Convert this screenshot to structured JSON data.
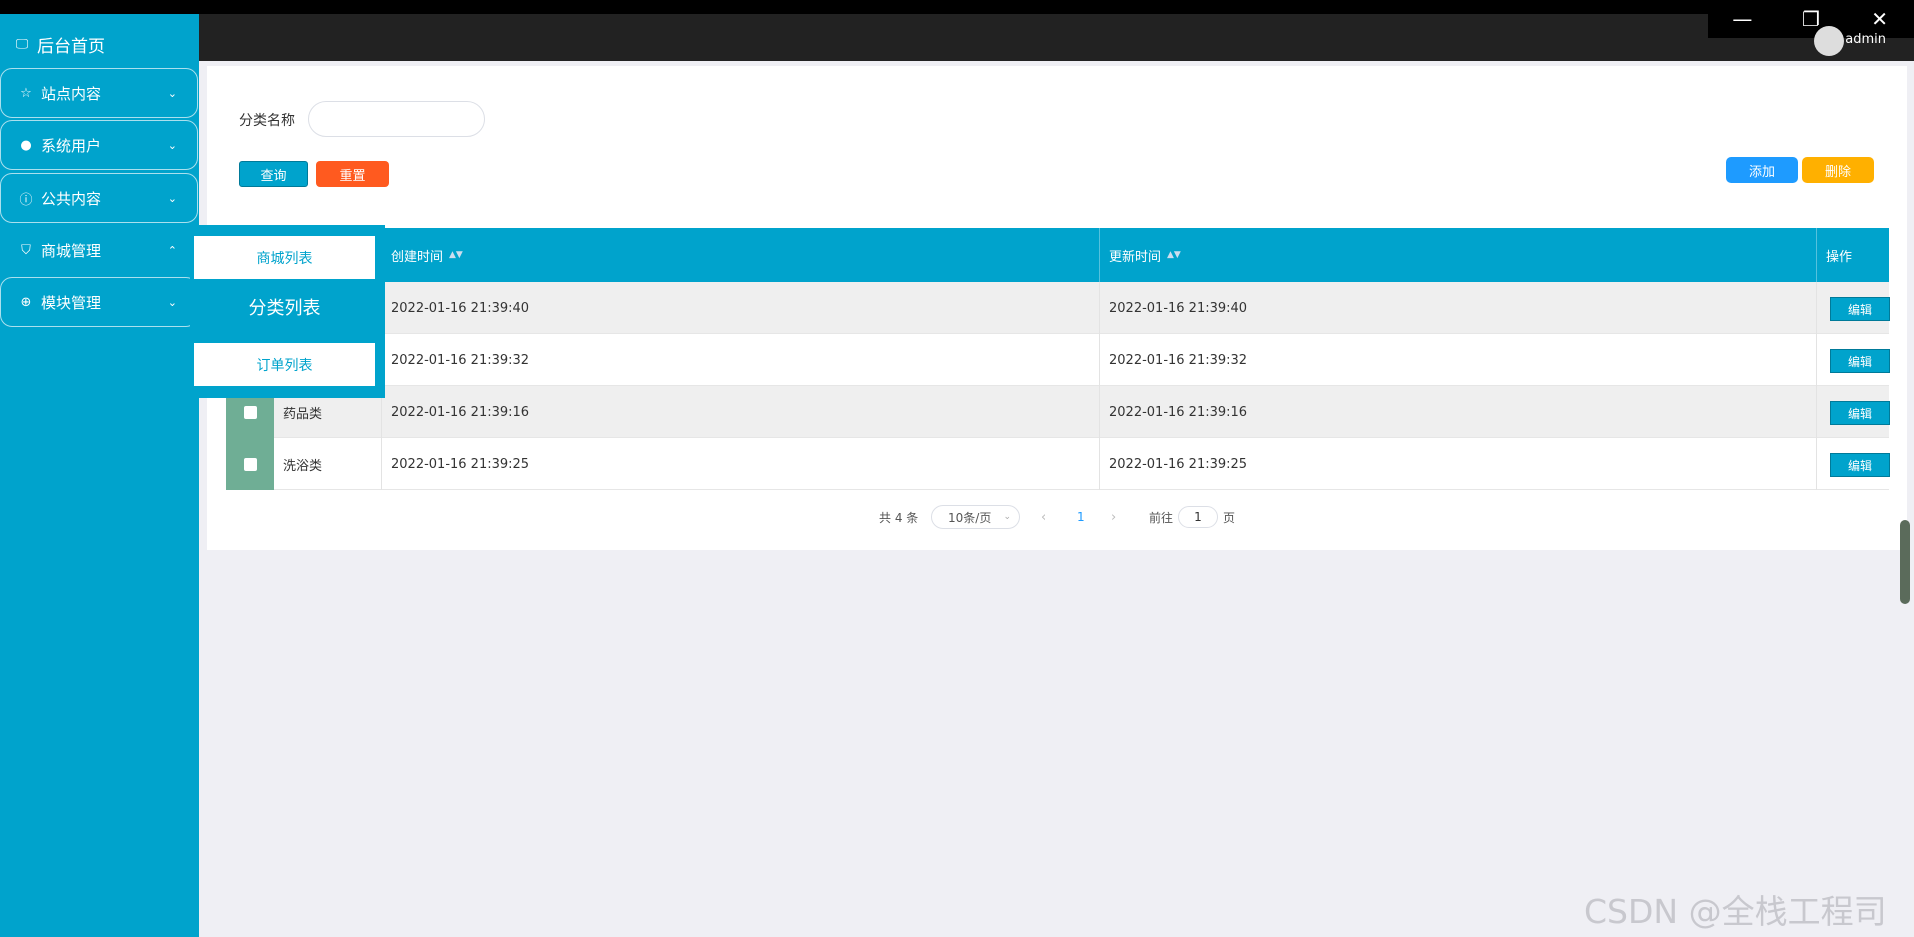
{
  "window": {
    "minimize": "—",
    "restore": "❐",
    "close": "✕"
  },
  "header": {
    "username": "admin"
  },
  "sidebar": {
    "home_label": "后台首页",
    "items": [
      {
        "label": "站点内容",
        "icon": "star-icon",
        "expanded": false
      },
      {
        "label": "系统用户",
        "icon": "user-icon",
        "expanded": false
      },
      {
        "label": "公共内容",
        "icon": "info-icon",
        "expanded": false
      },
      {
        "label": "商城管理",
        "icon": "bag-icon",
        "expanded": true
      },
      {
        "label": "模块管理",
        "icon": "plus-circle-icon",
        "expanded": false
      }
    ],
    "submenu": [
      "商城列表",
      "分类列表",
      "订单列表"
    ]
  },
  "search": {
    "label": "分类名称",
    "value": "",
    "placeholder": ""
  },
  "buttons": {
    "query": "查询",
    "reset": "重置",
    "add": "添加",
    "delete": "删除"
  },
  "table": {
    "headers": {
      "created": "创建时间",
      "updated": "更新时间",
      "action": "操作"
    },
    "rows": [
      {
        "name": "",
        "created": "2022-01-16 21:39:40",
        "updated": "2022-01-16 21:39:40",
        "edit": "编辑"
      },
      {
        "name": "",
        "created": "2022-01-16 21:39:32",
        "updated": "2022-01-16 21:39:32",
        "edit": "编辑"
      },
      {
        "name": "药品类",
        "created": "2022-01-16 21:39:16",
        "updated": "2022-01-16 21:39:16",
        "edit": "编辑"
      },
      {
        "name": "洗浴类",
        "created": "2022-01-16 21:39:25",
        "updated": "2022-01-16 21:39:25",
        "edit": "编辑"
      }
    ]
  },
  "pagination": {
    "total": "共 4 条",
    "page_size": "10条/页",
    "current": "1",
    "goto": "前往",
    "goto_value": "1",
    "page_unit": "页"
  },
  "watermark": "CSDN @全栈工程司",
  "colors": {
    "primary": "#00a3cc",
    "reset": "#ff5a1f",
    "add": "#1e9bff",
    "delete": "#ffb000"
  }
}
